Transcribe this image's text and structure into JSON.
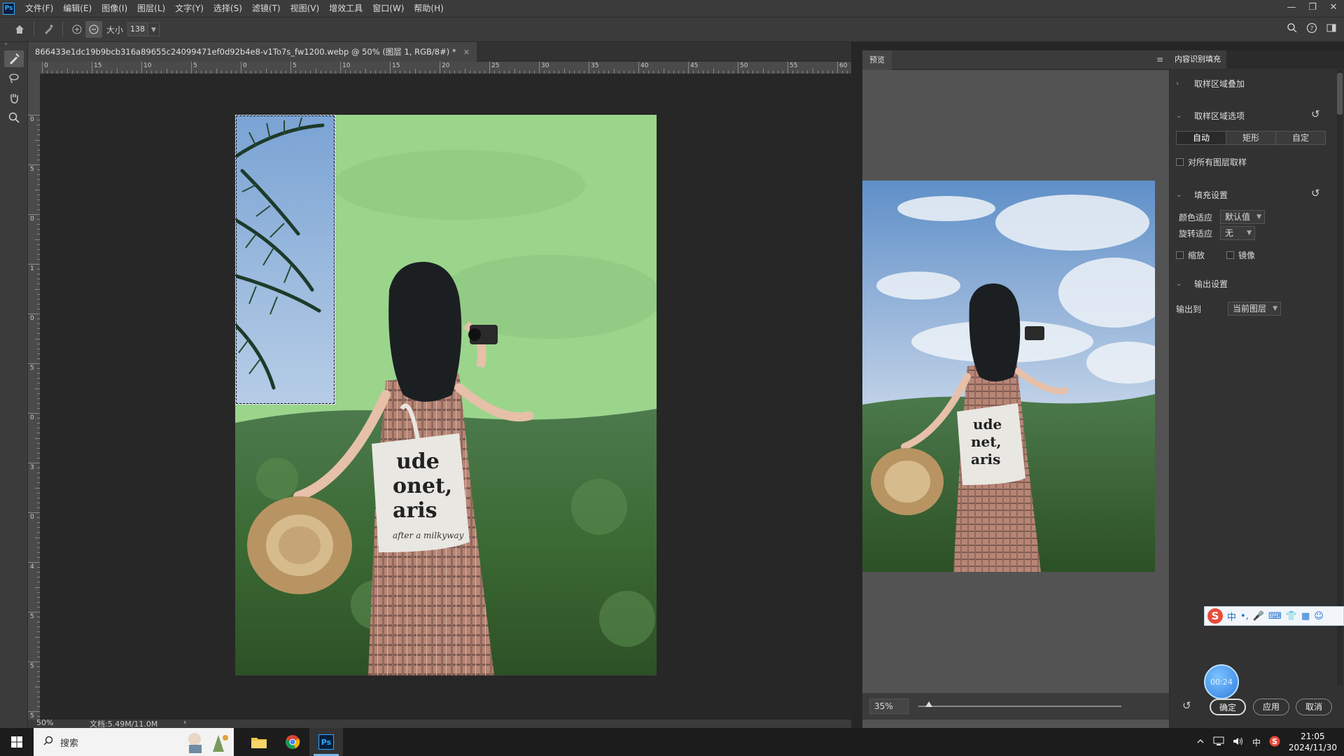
{
  "app": {
    "logo": "Ps",
    "menu": [
      "文件(F)",
      "编辑(E)",
      "图像(I)",
      "图层(L)",
      "文字(Y)",
      "选择(S)",
      "滤镜(T)",
      "视图(V)",
      "增效工具",
      "窗口(W)",
      "帮助(H)"
    ]
  },
  "options_bar": {
    "size_label": "大小",
    "size_value": "138"
  },
  "document": {
    "tab_title": "866433e1dc19b9bcb316a89655c24099471ef0d92b4e8-v1To7s_fw1200.webp @ 50% (图层 1, RGB/8#) *",
    "close_glyph": "×",
    "ruler_h_labels": [
      "0",
      "15",
      "10",
      "5",
      "0",
      "5",
      "10",
      "15",
      "20",
      "25",
      "30",
      "35",
      "40",
      "45",
      "50",
      "55",
      "60"
    ],
    "ruler_v_labels": [
      "0",
      "5",
      "0",
      "1",
      "0",
      "5",
      "0",
      "3",
      "0",
      "4",
      "5",
      "5",
      "5"
    ]
  },
  "status": {
    "zoom": "50%",
    "doc_info": "文档:5.49M/11.0M",
    "arrow": "›"
  },
  "preview": {
    "tab": "预览",
    "zoom": "35%",
    "zoom_fraction": 0.05
  },
  "right_panel": {
    "tab": "内容识别填充",
    "sec_overlay": "取样区域叠加",
    "sec_options": "取样区域选项",
    "seg_auto": "自动",
    "seg_rect": "矩形",
    "seg_custom": "自定",
    "sample_all_layers": "对所有图层取样",
    "sec_fill": "填充设置",
    "color_adapt_label": "颜色适应",
    "color_adapt_value": "默认值",
    "rotate_adapt_label": "旋转适应",
    "rotate_adapt_value": "无",
    "scale": "缩放",
    "mirror": "镜像",
    "sec_output": "输出设置",
    "output_to_label": "输出到",
    "output_to_value": "当前图层",
    "btn_ok": "确定",
    "btn_apply": "应用",
    "btn_cancel": "取消"
  },
  "ime": {
    "logo": "S",
    "items": [
      "中",
      "•,",
      "🎤",
      "⌨",
      "👕",
      "▦",
      "☺"
    ]
  },
  "timer": "00:24",
  "taskbar": {
    "search_placeholder": "搜索",
    "tray_lang": "中",
    "time": "21:05",
    "date": "2024/11/30"
  },
  "colors": {
    "accent": "#31a8ff",
    "panel": "#323232",
    "green_fill": "#9bd58c"
  }
}
